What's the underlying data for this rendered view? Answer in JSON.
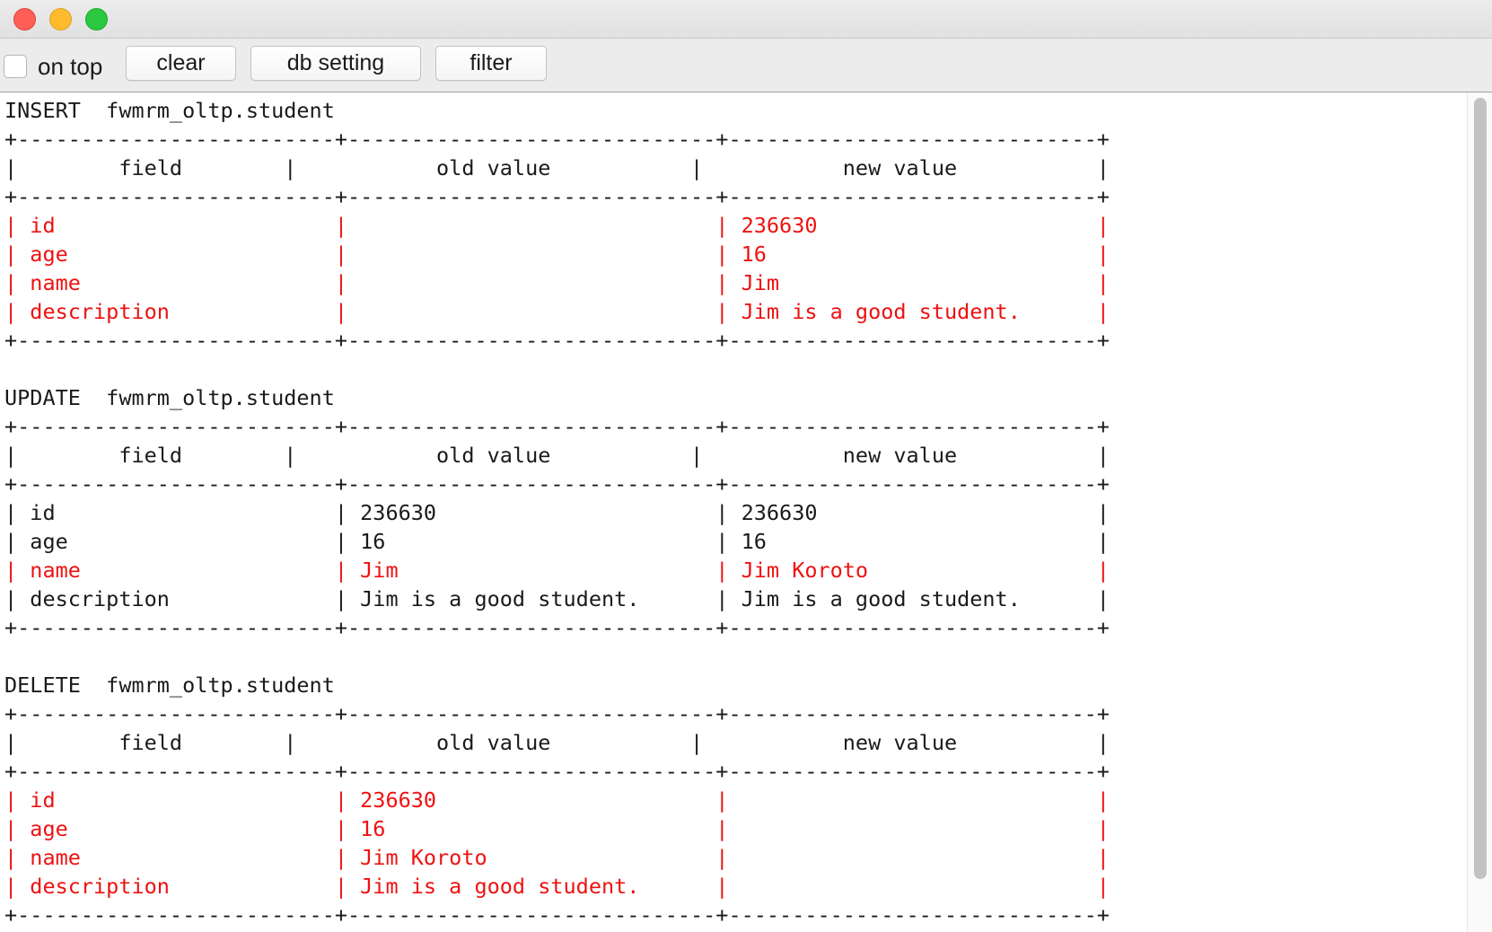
{
  "window": {
    "buttons": [
      "close",
      "minimize",
      "zoom"
    ]
  },
  "toolbar": {
    "on_top_label": "on top",
    "on_top_checked": false,
    "clear_label": "clear",
    "db_setting_label": "db setting",
    "filter_label": "filter"
  },
  "colors": {
    "changed_row": "#ee1111",
    "text": "#1a1a1a"
  },
  "console": {
    "lines": [
      {
        "text": "INSERT  fwmrm_oltp.student",
        "highlight": false
      },
      {
        "text": "+-------------------------+-----------------------------+-----------------------------+",
        "highlight": false
      },
      {
        "text": "|        field        |           old value           |           new value           |",
        "highlight": false
      },
      {
        "text": "+-------------------------+-----------------------------+-----------------------------+",
        "highlight": false
      },
      {
        "text": "| id                      |                             | 236630                      |",
        "highlight": true
      },
      {
        "text": "| age                     |                             | 16                          |",
        "highlight": true
      },
      {
        "text": "| name                    |                             | Jim                         |",
        "highlight": true
      },
      {
        "text": "| description             |                             | Jim is a good student.      |",
        "highlight": true
      },
      {
        "text": "+-------------------------+-----------------------------+-----------------------------+",
        "highlight": false
      },
      {
        "text": "",
        "highlight": false
      },
      {
        "text": "UPDATE  fwmrm_oltp.student",
        "highlight": false
      },
      {
        "text": "+-------------------------+-----------------------------+-----------------------------+",
        "highlight": false
      },
      {
        "text": "|        field        |           old value           |           new value           |",
        "highlight": false
      },
      {
        "text": "+-------------------------+-----------------------------+-----------------------------+",
        "highlight": false
      },
      {
        "text": "| id                      | 236630                      | 236630                      |",
        "highlight": false
      },
      {
        "text": "| age                     | 16                          | 16                          |",
        "highlight": false
      },
      {
        "text": "| name                    | Jim                         | Jim Koroto                  |",
        "highlight": true
      },
      {
        "text": "| description             | Jim is a good student.      | Jim is a good student.      |",
        "highlight": false
      },
      {
        "text": "+-------------------------+-----------------------------+-----------------------------+",
        "highlight": false
      },
      {
        "text": "",
        "highlight": false
      },
      {
        "text": "DELETE  fwmrm_oltp.student",
        "highlight": false
      },
      {
        "text": "+-------------------------+-----------------------------+-----------------------------+",
        "highlight": false
      },
      {
        "text": "|        field        |           old value           |           new value           |",
        "highlight": false
      },
      {
        "text": "+-------------------------+-----------------------------+-----------------------------+",
        "highlight": false
      },
      {
        "text": "| id                      | 236630                      |                             |",
        "highlight": true
      },
      {
        "text": "| age                     | 16                          |                             |",
        "highlight": true
      },
      {
        "text": "| name                    | Jim Koroto                  |                             |",
        "highlight": true
      },
      {
        "text": "| description             | Jim is a good student.      |                             |",
        "highlight": true
      },
      {
        "text": "+-------------------------+-----------------------------+-----------------------------+",
        "highlight": false
      }
    ]
  }
}
